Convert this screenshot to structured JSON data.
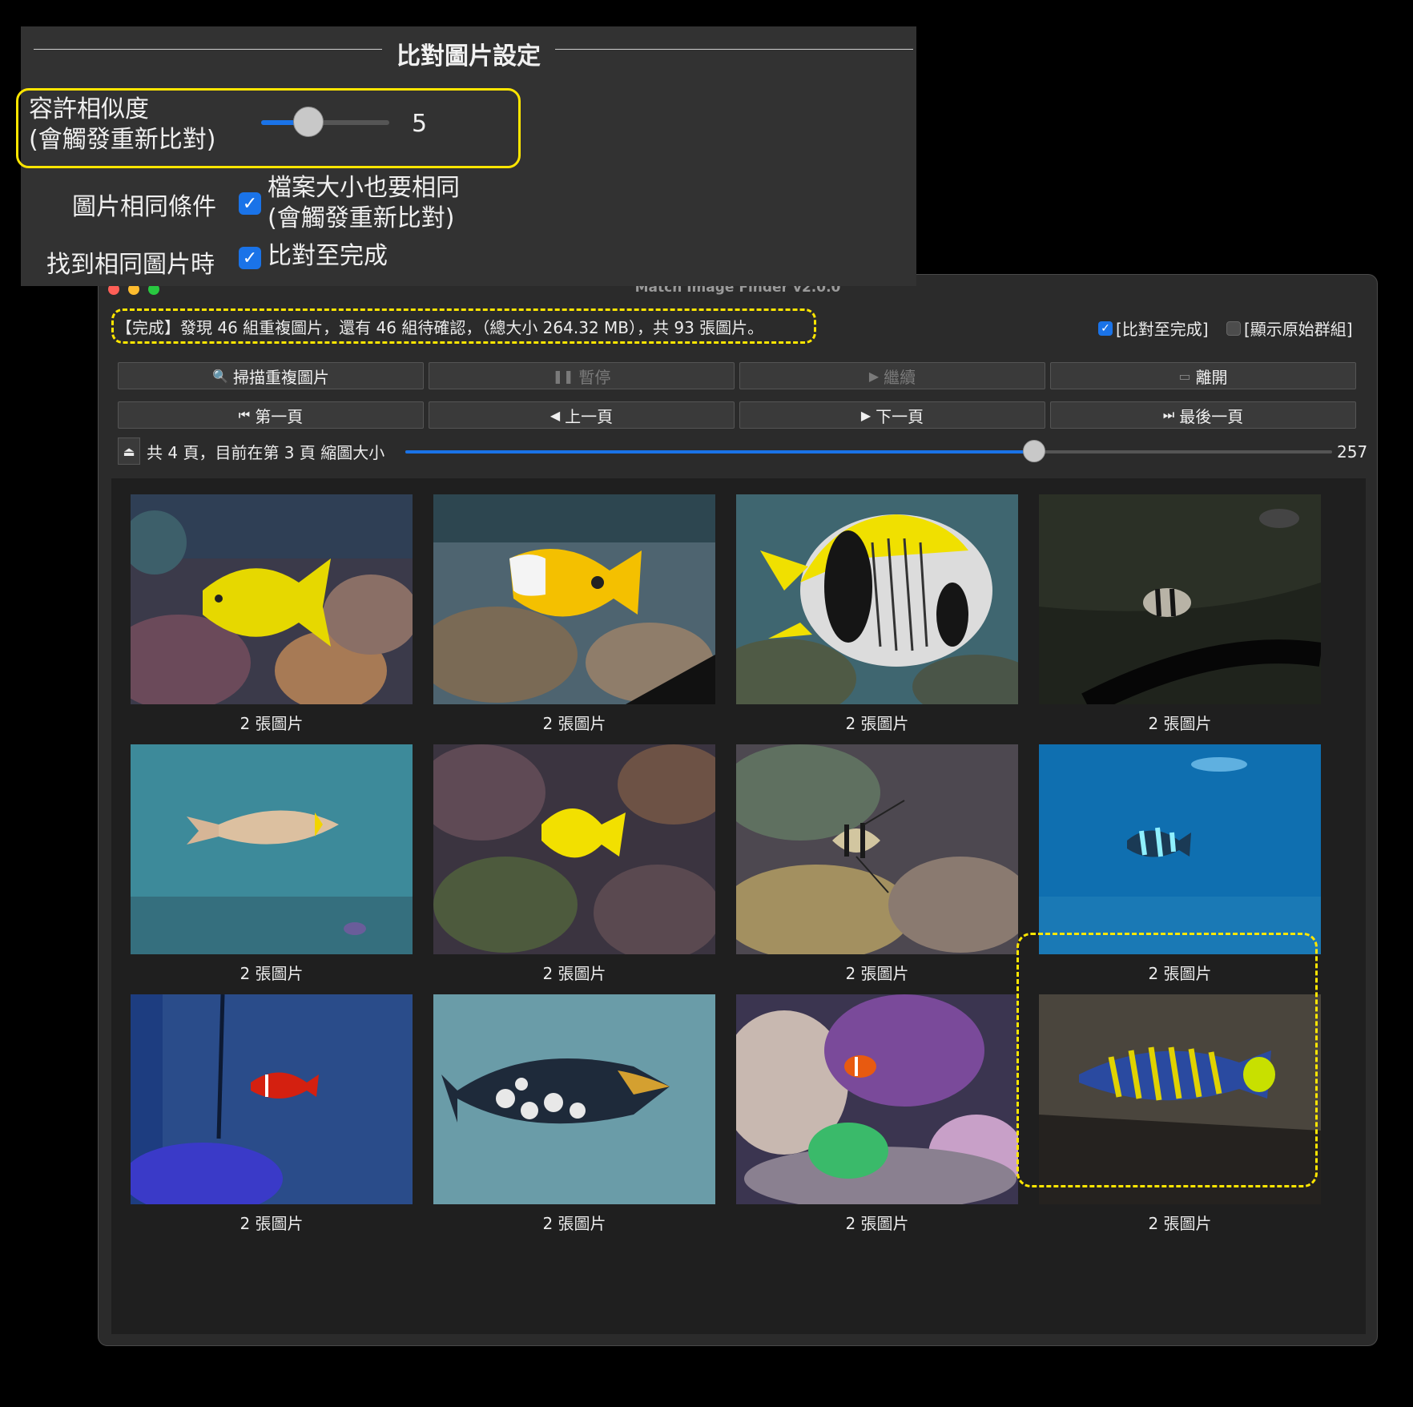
{
  "window": {
    "title": "Match Image Finder v2.0.0"
  },
  "status": {
    "text": "【完成】發現 46 組重複圖片，還有 46 組待確認，（總大小 264.32 MB），共 93 張圖片。"
  },
  "options": {
    "compare_to_end": {
      "label": "[比對至完成]",
      "checked": true
    },
    "show_original_groups": {
      "label": "[顯示原始群組]",
      "checked": false
    }
  },
  "toolbar": {
    "scan": {
      "label": "掃描重複圖片",
      "icon": "magnifier-icon",
      "enabled": true
    },
    "pause": {
      "label": "暫停",
      "icon": "pause-icon",
      "enabled": false
    },
    "continue": {
      "label": "繼續",
      "icon": "play-icon",
      "enabled": false
    },
    "exit": {
      "label": "離開",
      "icon": "exit-icon",
      "enabled": true
    }
  },
  "navigation": {
    "first": {
      "label": "第一頁",
      "icon": "skip-first-icon"
    },
    "prev": {
      "label": "上一頁",
      "icon": "prev-icon"
    },
    "next": {
      "label": "下一頁",
      "icon": "next-icon"
    },
    "last": {
      "label": "最後一頁",
      "icon": "skip-last-icon"
    }
  },
  "pager": {
    "text": "共 4 頁，目前在第 3 頁 縮圖大小",
    "thumb_size_value": "257"
  },
  "thumbnails": [
    {
      "caption": "2 張圖片",
      "subject": "yellow-tang-on-coral"
    },
    {
      "caption": "2 張圖片",
      "subject": "yellow-foxface-rabbitfish"
    },
    {
      "caption": "2 張圖片",
      "subject": "lined-butterflyfish"
    },
    {
      "caption": "2 張圖片",
      "subject": "dark-tank-striped-fish"
    },
    {
      "caption": "2 張圖片",
      "subject": "unicornfish-in-blue-tank"
    },
    {
      "caption": "2 張圖片",
      "subject": "yellow-tang-on-reef"
    },
    {
      "caption": "2 張圖片",
      "subject": "banggai-cardinalfish"
    },
    {
      "caption": "2 張圖片",
      "subject": "blurry-fish-in-blue-water"
    },
    {
      "caption": "2 張圖片",
      "subject": "tomato-clownfish-blue-tank"
    },
    {
      "caption": "2 張圖片",
      "subject": "clown-triggerfish"
    },
    {
      "caption": "2 張圖片",
      "subject": "clownfish-with-anemone"
    },
    {
      "caption": "2 張圖片",
      "subject": "regal-angelfish"
    }
  ],
  "settings": {
    "title": "比對圖片設定",
    "similarity": {
      "label_line1": "容許相似度",
      "label_line2": "(會觸發重新比對)",
      "value": "5"
    },
    "same_condition": {
      "label": "圖片相同條件",
      "option_line1": "檔案大小也要相同",
      "option_line2": "(會觸發重新比對)",
      "checked": true
    },
    "on_found": {
      "label": "找到相同圖片時",
      "option": "比對至完成",
      "checked": true
    }
  },
  "colors": {
    "accent": "#1a73e8",
    "highlight": "#ffe600",
    "window_bg": "#2b2b2b",
    "panel_bg": "#323232"
  }
}
